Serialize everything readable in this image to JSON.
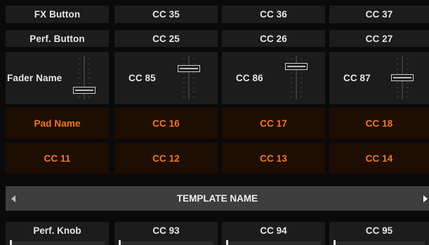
{
  "rows": {
    "fx": [
      "FX Button",
      "CC 35",
      "CC 36",
      "CC 37"
    ],
    "perf": [
      "Perf. Button",
      "CC 25",
      "CC 26",
      "CC 27"
    ],
    "faders": [
      {
        "label": "Fader Name",
        "level": 0.15
      },
      {
        "label": "CC 85",
        "level": 0.75
      },
      {
        "label": "CC 86",
        "level": 0.8
      },
      {
        "label": "CC 87",
        "level": 0.5
      }
    ],
    "pads1": [
      "Pad Name",
      "CC 16",
      "CC 17",
      "CC 18"
    ],
    "pads2": [
      "CC 11",
      "CC 12",
      "CC 13",
      "CC 14"
    ],
    "knobs": [
      "Perf. Knob",
      "CC 93",
      "CC 94",
      "CC 95"
    ]
  },
  "template": {
    "name": "TEMPLATE NAME"
  },
  "colors": {
    "accent": "#f07a18",
    "pad_background": "#1e0d02",
    "cell_background": "#1c1c1c"
  }
}
